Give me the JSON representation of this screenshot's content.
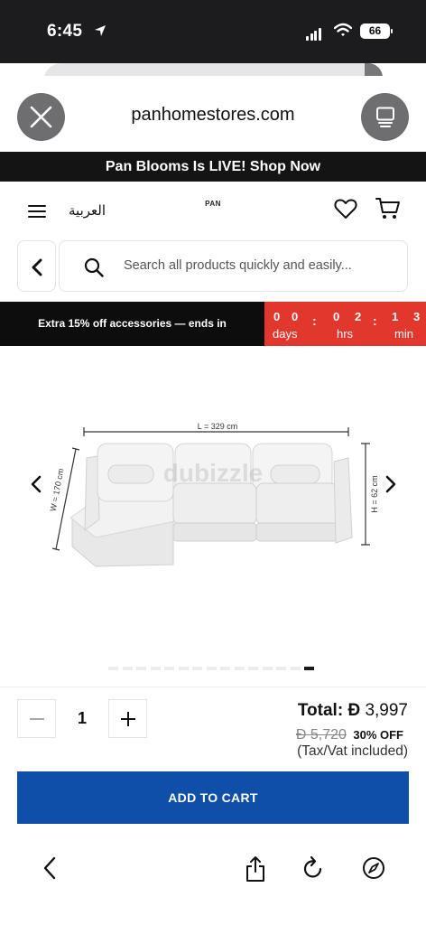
{
  "status_bar": {
    "time": "6:45",
    "battery": "66"
  },
  "browser": {
    "url": "panhomestores.com"
  },
  "promo_banner": "Pan Blooms Is LIVE! Shop Now",
  "header": {
    "language_link": "العربية",
    "logo": "PAN"
  },
  "search": {
    "placeholder": "Search all products quickly and easily..."
  },
  "offer": {
    "text": "Extra 15% off accessories — ends in",
    "countdown": {
      "days": [
        "0",
        "0"
      ],
      "hrs": [
        "0",
        "2"
      ],
      "min": [
        "1",
        "3"
      ],
      "labels": {
        "days": "days",
        "hrs": "hrs",
        "min": "min"
      }
    }
  },
  "product": {
    "dimensions": {
      "length": "L = 329 cm",
      "width": "W = 170 cm",
      "height": "H = 62 cm"
    },
    "watermark": "dubizzle",
    "gallery_count": 15,
    "gallery_active_index": 14
  },
  "cart": {
    "quantity": "1",
    "total_label": "Total:",
    "currency_symbol": "Đ",
    "total_price": "3,997",
    "old_price": "5,720",
    "discount": "30% OFF",
    "tax_note": "(Tax/Vat included)",
    "add_to_cart": "ADD TO CART"
  },
  "colors": {
    "cta": "#0f4faa",
    "countdown": "#e1372c",
    "banner": "#141414"
  },
  "icons": [
    "location-arrow-icon",
    "signal-icon",
    "wifi-icon",
    "close-icon",
    "tabs-icon",
    "menu-icon",
    "heart-icon",
    "cart-icon",
    "back-icon",
    "search-icon",
    "chevron-left-icon",
    "chevron-right-icon",
    "minus-icon",
    "plus-icon",
    "share-icon",
    "reload-icon",
    "compass-icon"
  ]
}
